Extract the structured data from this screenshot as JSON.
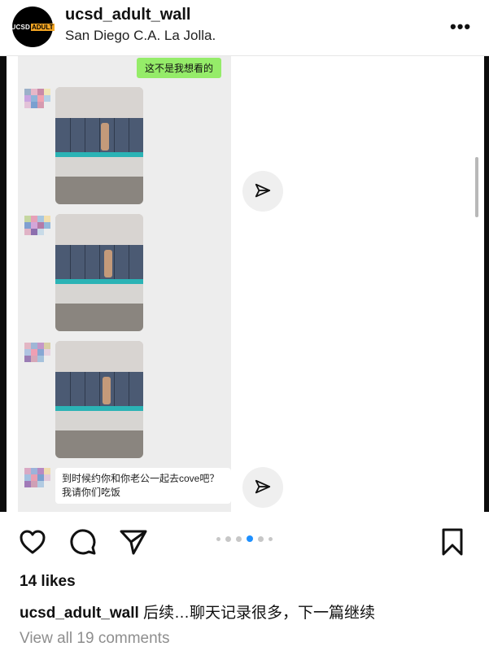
{
  "header": {
    "avatar_text_left": "UCSD",
    "avatar_text_right": "ADULT",
    "username": "ucsd_adult_wall",
    "location": "San Diego C.A. La Jolla.",
    "more_icon": "more-horizontal-icon"
  },
  "chat": {
    "my_message": "这不是我想看的",
    "reply_text": "到时候约你和你老公一起去cove吧？我请你们吃饭"
  },
  "actions": {
    "icons": [
      "heart-icon",
      "comment-icon",
      "share-icon",
      "bookmark-icon"
    ],
    "carousel_total": 6,
    "carousel_active_index": 3
  },
  "post": {
    "likes": "14 likes",
    "caption_user": "ucsd_adult_wall",
    "caption_text": " 后续…聊天记录很多，下一篇继续",
    "view_comments": "View all 19 comments"
  },
  "colors": {
    "accent_blue": "#1e90ff",
    "chat_bg": "#ededed",
    "my_bubble": "#95ec69",
    "avatar_orange": "#f5a623"
  }
}
